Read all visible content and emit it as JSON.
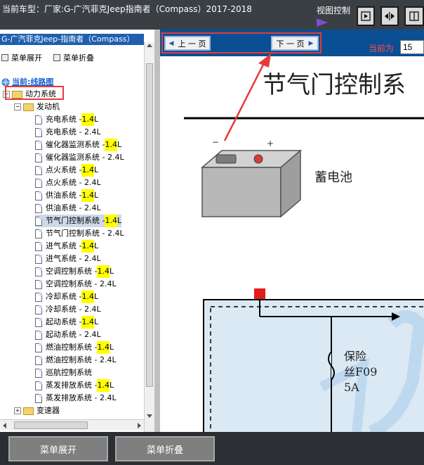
{
  "header": {
    "title": "当前车型：厂家:G-广汽菲克Jeep指南者（Compass）2017-2018",
    "view_label": "视图控制",
    "view_buttons": [
      "next-page-icon",
      "fit-width-icon",
      "fit-page-icon"
    ]
  },
  "sidebar": {
    "head": "G-广汽菲克Jeep-指南者（Compass）",
    "expand_label": "菜单展开",
    "collapse_label": "菜单折叠",
    "current_label": "当前:线路图",
    "root_label": "动力系统",
    "engine_label": "发动机",
    "items": [
      {
        "label": "充电系统 - ",
        "hl": "1.4",
        "tail": "L"
      },
      {
        "label": "充电系统 - 2.4L",
        "hl": "",
        "tail": ""
      },
      {
        "label": "催化器监测系统 - ",
        "hl": "1.4",
        "tail": "L"
      },
      {
        "label": "催化器监测系统 - 2.4L",
        "hl": "",
        "tail": ""
      },
      {
        "label": "点火系统 - ",
        "hl": "1.4",
        "tail": "L"
      },
      {
        "label": "点火系统 - 2.4L",
        "hl": "",
        "tail": ""
      },
      {
        "label": "供油系统 - ",
        "hl": "1.4",
        "tail": "L"
      },
      {
        "label": "供油系统 - 2.4L",
        "hl": "",
        "tail": ""
      },
      {
        "label": "节气门控制系统 - ",
        "hl": "1.4",
        "tail": "L"
      },
      {
        "label": "节气门控制系统 - 2.4L",
        "hl": "",
        "tail": ""
      },
      {
        "label": "进气系统 - ",
        "hl": "1.4",
        "tail": "L"
      },
      {
        "label": "进气系统 - 2.4L",
        "hl": "",
        "tail": ""
      },
      {
        "label": "空调控制系统 - ",
        "hl": "1.4",
        "tail": "L"
      },
      {
        "label": "空调控制系统 - 2.4L",
        "hl": "",
        "tail": ""
      },
      {
        "label": "冷却系统 - ",
        "hl": "1.4",
        "tail": "L"
      },
      {
        "label": "冷却系统 - 2.4L",
        "hl": "",
        "tail": ""
      },
      {
        "label": "起动系统 - ",
        "hl": "1.4",
        "tail": "L"
      },
      {
        "label": "起动系统 - 2.4L",
        "hl": "",
        "tail": ""
      },
      {
        "label": "燃油控制系统 - ",
        "hl": "1.4",
        "tail": "L"
      },
      {
        "label": "燃油控制系统 - 2.4L",
        "hl": "",
        "tail": ""
      },
      {
        "label": "巡航控制系统",
        "hl": "",
        "tail": ""
      },
      {
        "label": "蒸发排放系统 - ",
        "hl": "1.4",
        "tail": "L"
      },
      {
        "label": "蒸发排放系统 - 2.4L",
        "hl": "",
        "tail": ""
      }
    ],
    "selected_index": 8,
    "transmission_label": "变速器"
  },
  "nav": {
    "prev_label": "上 一 页",
    "next_label": "下 一 页",
    "current_label": "当前为",
    "page_value": "15"
  },
  "diagram": {
    "title": "节气门控制系",
    "battery_label": "蓄电池",
    "fuse_label": "保险",
    "fuse_code": "丝F09",
    "fuse_amp": "5A"
  },
  "footer": {
    "expand_label": "菜单展开",
    "collapse_label": "菜单折叠"
  },
  "colors": {
    "highlight": "#ffff00",
    "annotation_red": "#e53b3b",
    "panel_blue": "#0a4f93"
  }
}
